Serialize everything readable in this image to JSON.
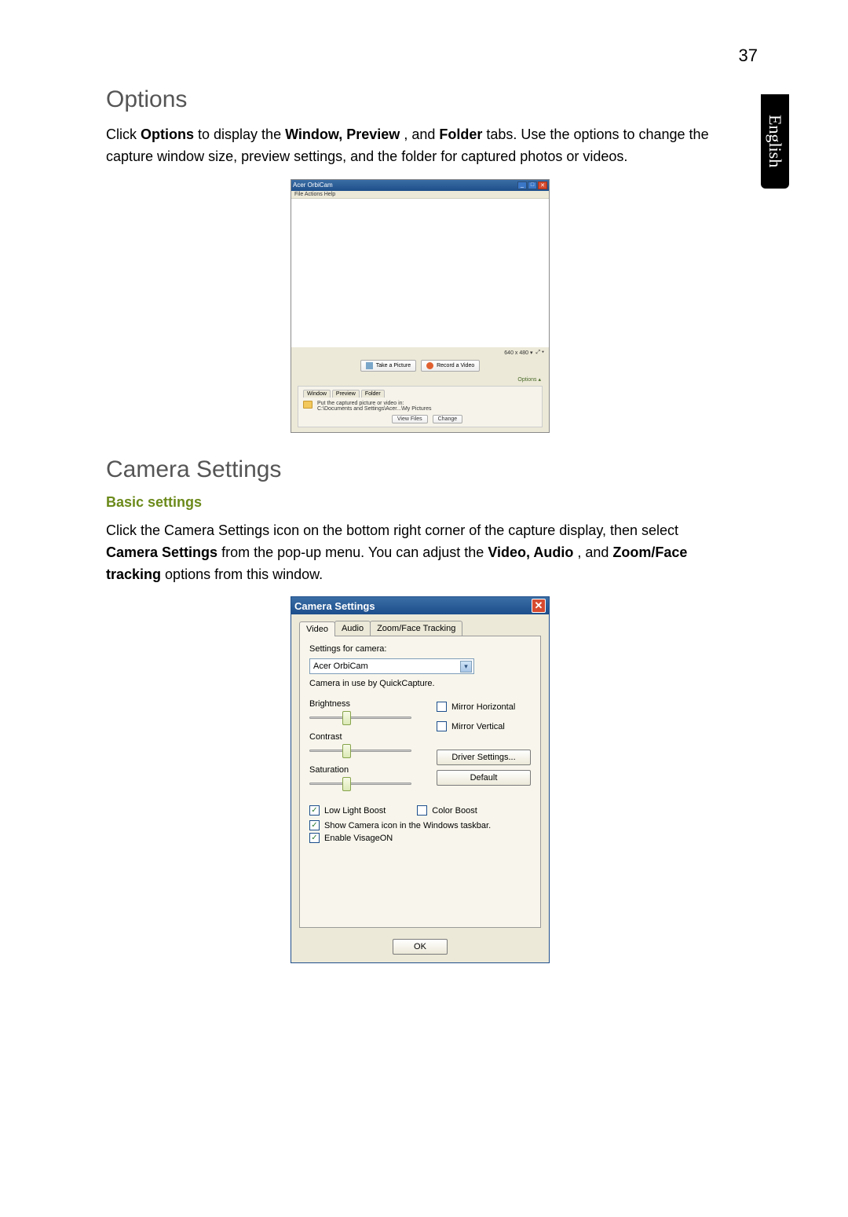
{
  "page_number": "37",
  "lang_tab": "English",
  "sect_options": "Options",
  "para_options_1": "Click ",
  "para_options_b1": "Options",
  "para_options_2": " to display the ",
  "para_options_b2": "Window, Preview",
  "para_options_3": ", and ",
  "para_options_b3": "Folder",
  "para_options_4": " tabs. Use the options to change the capture window size, preview settings, and the folder for captured photos or videos.",
  "orbicam": {
    "title": "Acer OrbiCam",
    "menu": "File   Actions   Help",
    "status": "640 x 480 ▾",
    "status2": "⤢ ▾",
    "take": "Take a Picture",
    "record": "Record a Video",
    "options_link": "Options  ▴",
    "tab_window": "Window",
    "tab_preview": "Preview",
    "tab_folder": "Folder",
    "folder_msg": "Put the captured picture or video in:",
    "folder_path": "C:\\Documents and Settings\\Acer...\\My Pictures",
    "view_files": "View Files",
    "change": "Change"
  },
  "sect_camera": "Camera Settings",
  "sub_basic": "Basic settings",
  "para_cam_1": "Click the Camera Settings icon on the bottom right corner of the capture display, then select ",
  "para_cam_b1": "Camera Settings",
  "para_cam_2": " from the pop-up menu. You can adjust the ",
  "para_cam_b2": "Video, Audio",
  "para_cam_3": ", and ",
  "para_cam_b3": "Zoom/Face tracking",
  "para_cam_4": " options from this window.",
  "camset": {
    "title": "Camera Settings",
    "tab_video": "Video",
    "tab_audio": "Audio",
    "tab_zoom": "Zoom/Face Tracking",
    "settings_for": "Settings for camera:",
    "camera_name": "Acer OrbiCam",
    "in_use": "Camera in use by QuickCapture.",
    "brightness": "Brightness",
    "contrast": "Contrast",
    "saturation": "Saturation",
    "mirror_h": "Mirror Horizontal",
    "mirror_v": "Mirror Vertical",
    "driver": "Driver Settings...",
    "default": "Default",
    "low_light": "Low Light Boost",
    "color_boost": "Color Boost",
    "show_icon": "Show Camera icon in the Windows taskbar.",
    "enable_v": "Enable VisageON",
    "ok": "OK"
  }
}
